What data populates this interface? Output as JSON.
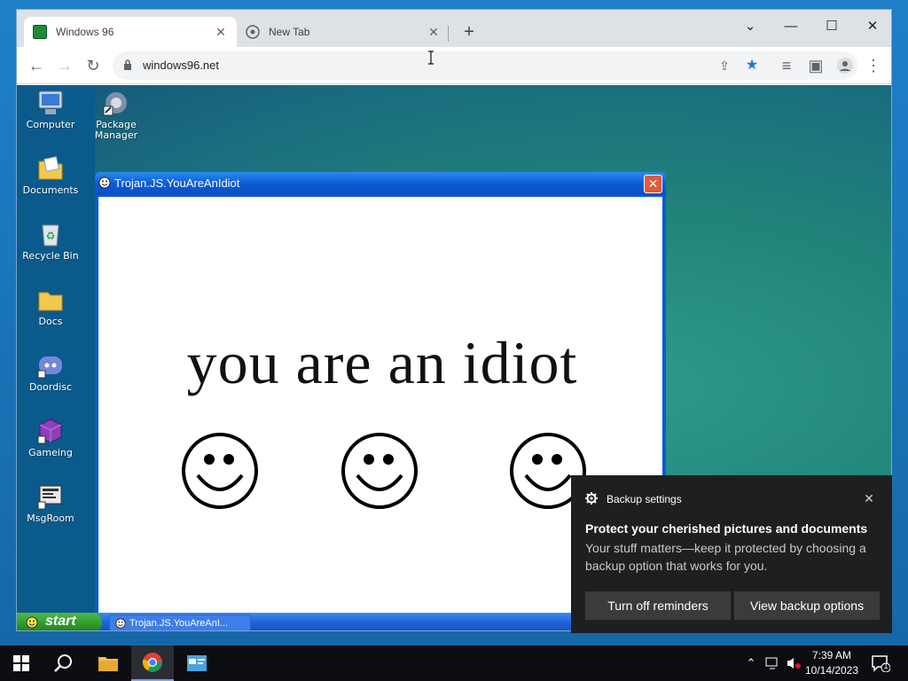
{
  "browser": {
    "tabs": [
      {
        "title": "Windows 96",
        "active": true,
        "favicon": "windows96-icon"
      },
      {
        "title": "New Tab",
        "active": false,
        "favicon": "chrome-icon"
      }
    ],
    "new_tab_label": "+",
    "url": "windows96.net"
  },
  "desktop_icons": [
    {
      "label": "Computer",
      "icon": "computer-icon"
    },
    {
      "label": "Package Manager",
      "icon": "package-manager-icon"
    },
    {
      "label": "Documents",
      "icon": "documents-folder-icon"
    },
    {
      "label": "Recycle Bin",
      "icon": "recycle-bin-icon"
    },
    {
      "label": "Docs",
      "icon": "folder-icon"
    },
    {
      "label": "Doordisc",
      "icon": "discord-icon"
    },
    {
      "label": "Gameing",
      "icon": "cube-icon"
    },
    {
      "label": "MsgRoom",
      "icon": "msgroom-icon"
    }
  ],
  "trojan_window": {
    "title": "Trojan.JS.YouAreAnIdiot",
    "close_label": "✕",
    "message": "you are an idiot"
  },
  "w96_taskbar": {
    "start_label": "start",
    "task_label": "Trojan.JS.YouAreAnI..."
  },
  "toast": {
    "app_name": "Backup settings",
    "title": "Protect your cherished pictures and documents",
    "body": "Your stuff matters—keep it protected by choosing a backup option that works for you.",
    "button_1": "Turn off reminders",
    "button_2": "View backup options",
    "close_label": "✕"
  },
  "taskbar": {
    "time": "7:39 AM",
    "date": "10/14/2023",
    "notification_count": "1"
  },
  "colors": {
    "w96_titlebar": "#0c5bd8",
    "w96_start": "#2e9a2c",
    "toast_bg": "#1f1f1f",
    "star_accent": "#1a73e8"
  }
}
